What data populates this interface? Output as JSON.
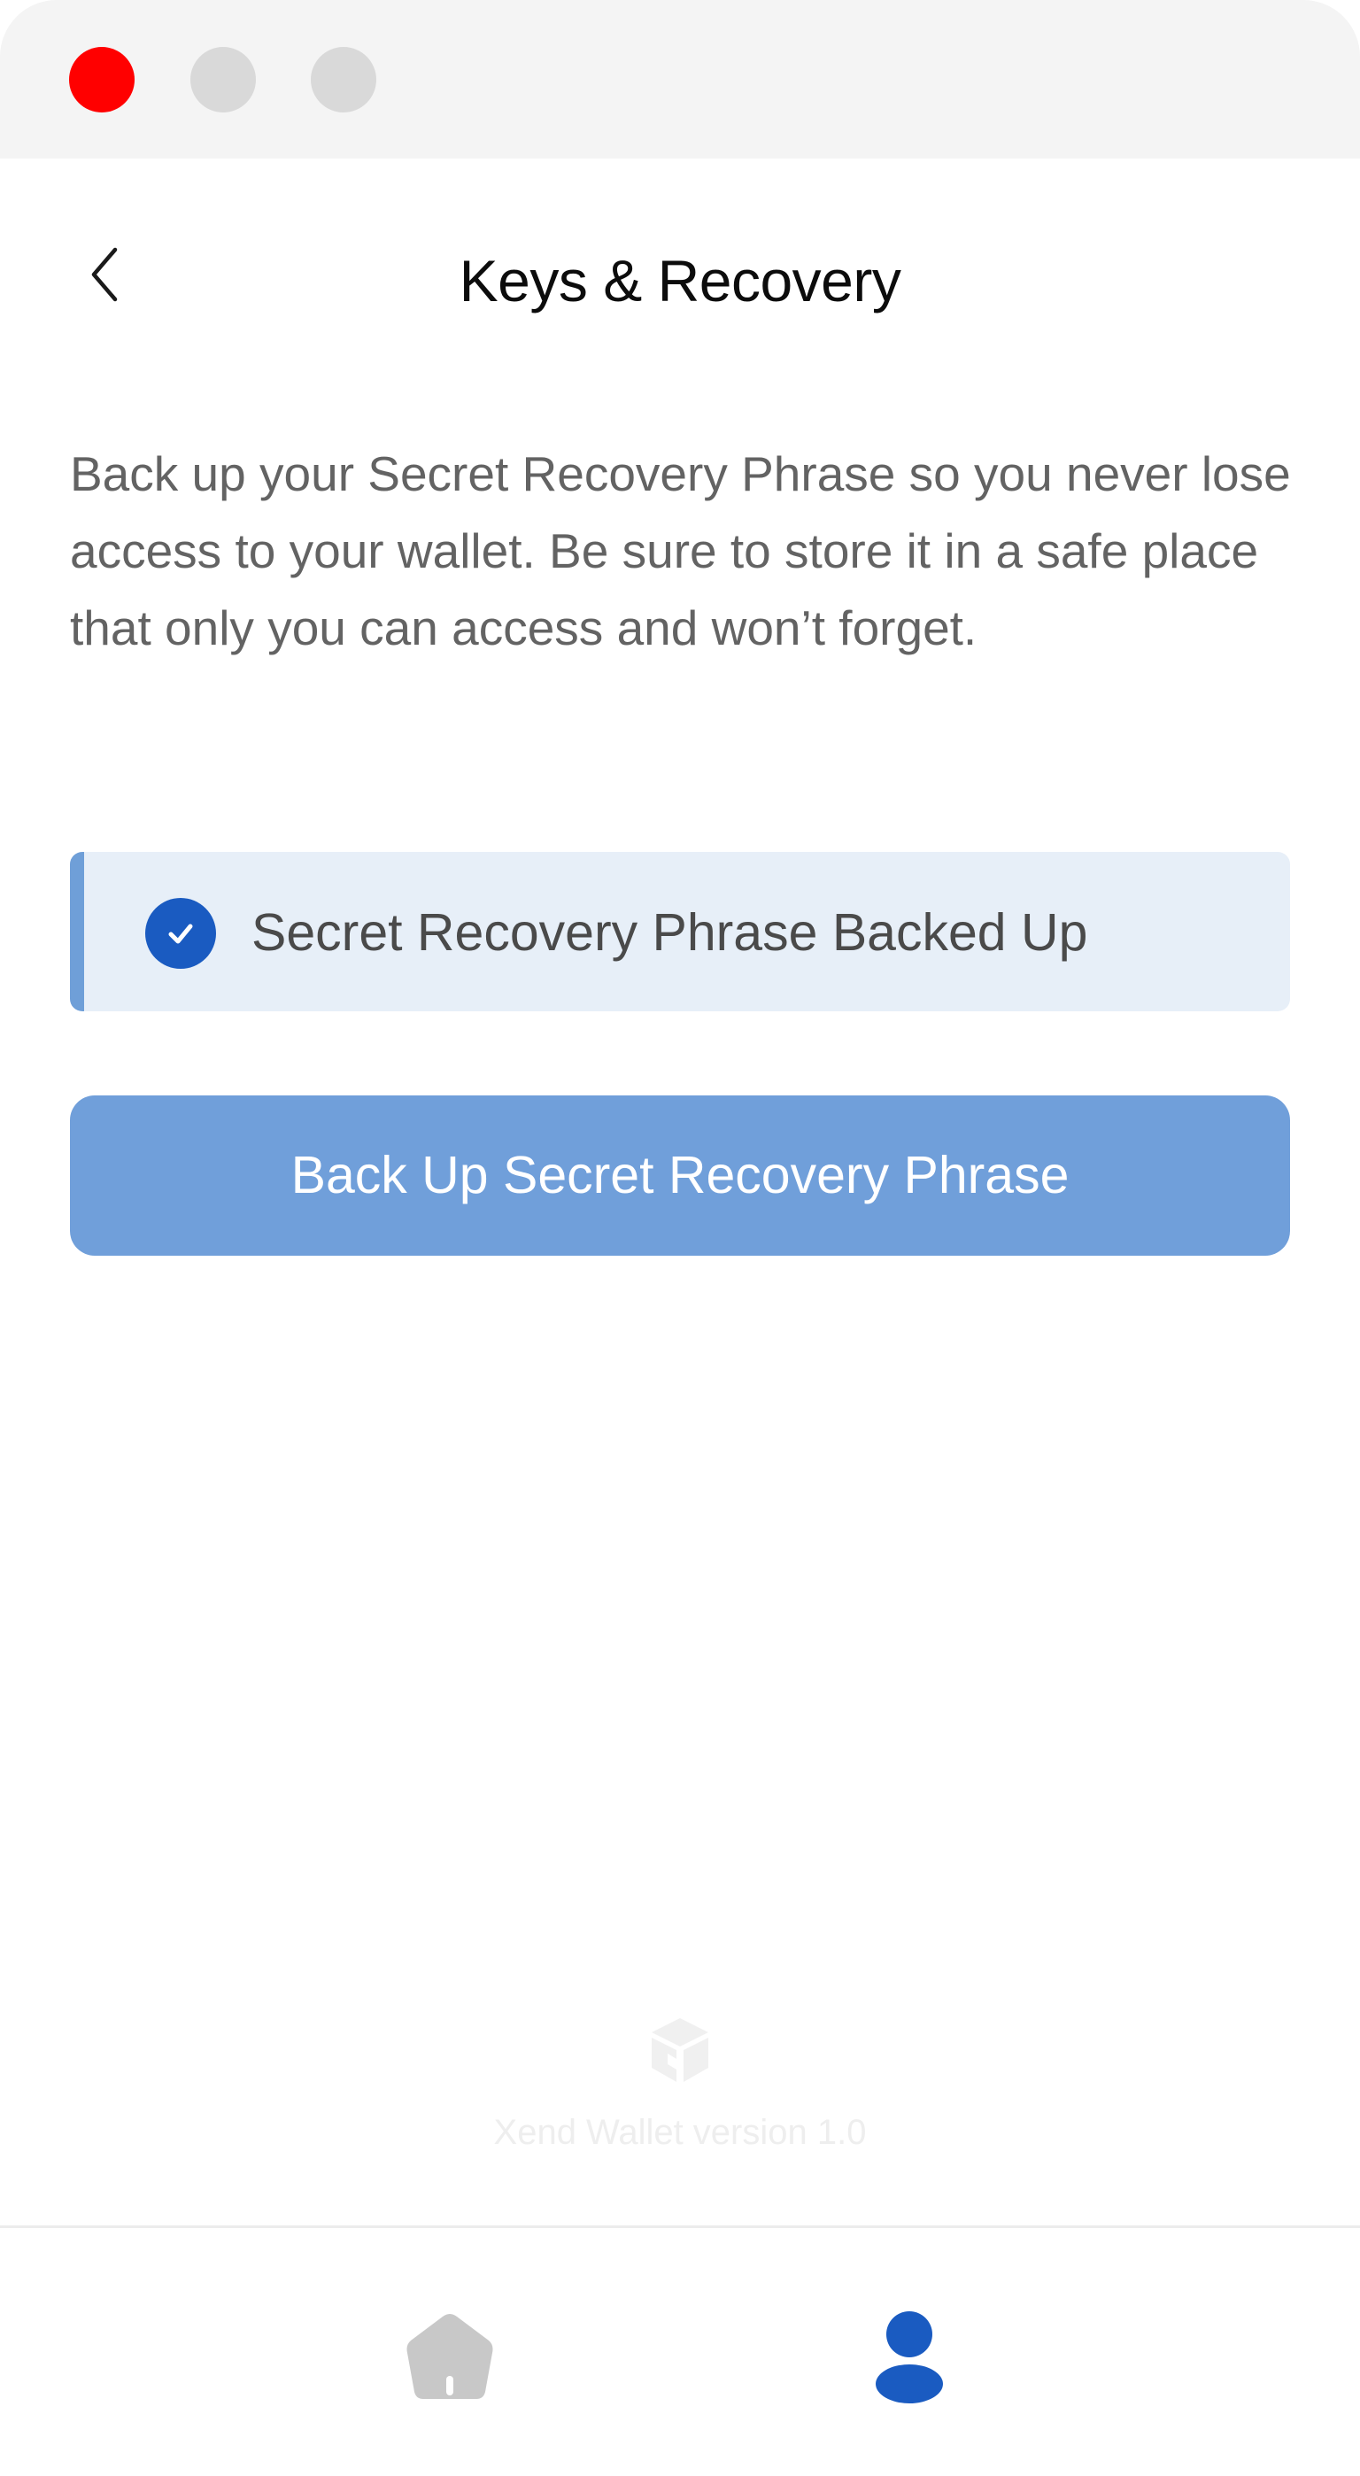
{
  "window": {
    "controls": {
      "close_color": "#ff0000",
      "inactive_color": "#d9d9d9"
    }
  },
  "header": {
    "back_icon": "chevron-left-icon",
    "title": "Keys & Recovery"
  },
  "main": {
    "description": "Back up your Secret Recovery Phrase so you never lose access to your wallet. Be sure to store it in a safe place that only you can access and won’t forget.",
    "status": {
      "icon": "check-circle-icon",
      "text": "Secret Recovery Phrase Backed Up",
      "accent_color": "#1a5bc1"
    },
    "backup_button_label": "Back Up Secret Recovery Phrase"
  },
  "footer": {
    "logo_icon": "xend-cube-logo-icon",
    "version": "Xend Wallet version 1.0"
  },
  "bottom_nav": {
    "items": [
      {
        "id": "home",
        "icon": "home-icon",
        "active": false,
        "color": "#c8c8c8"
      },
      {
        "id": "profile",
        "icon": "user-icon",
        "active": true,
        "color": "#1a5bc1"
      }
    ]
  }
}
